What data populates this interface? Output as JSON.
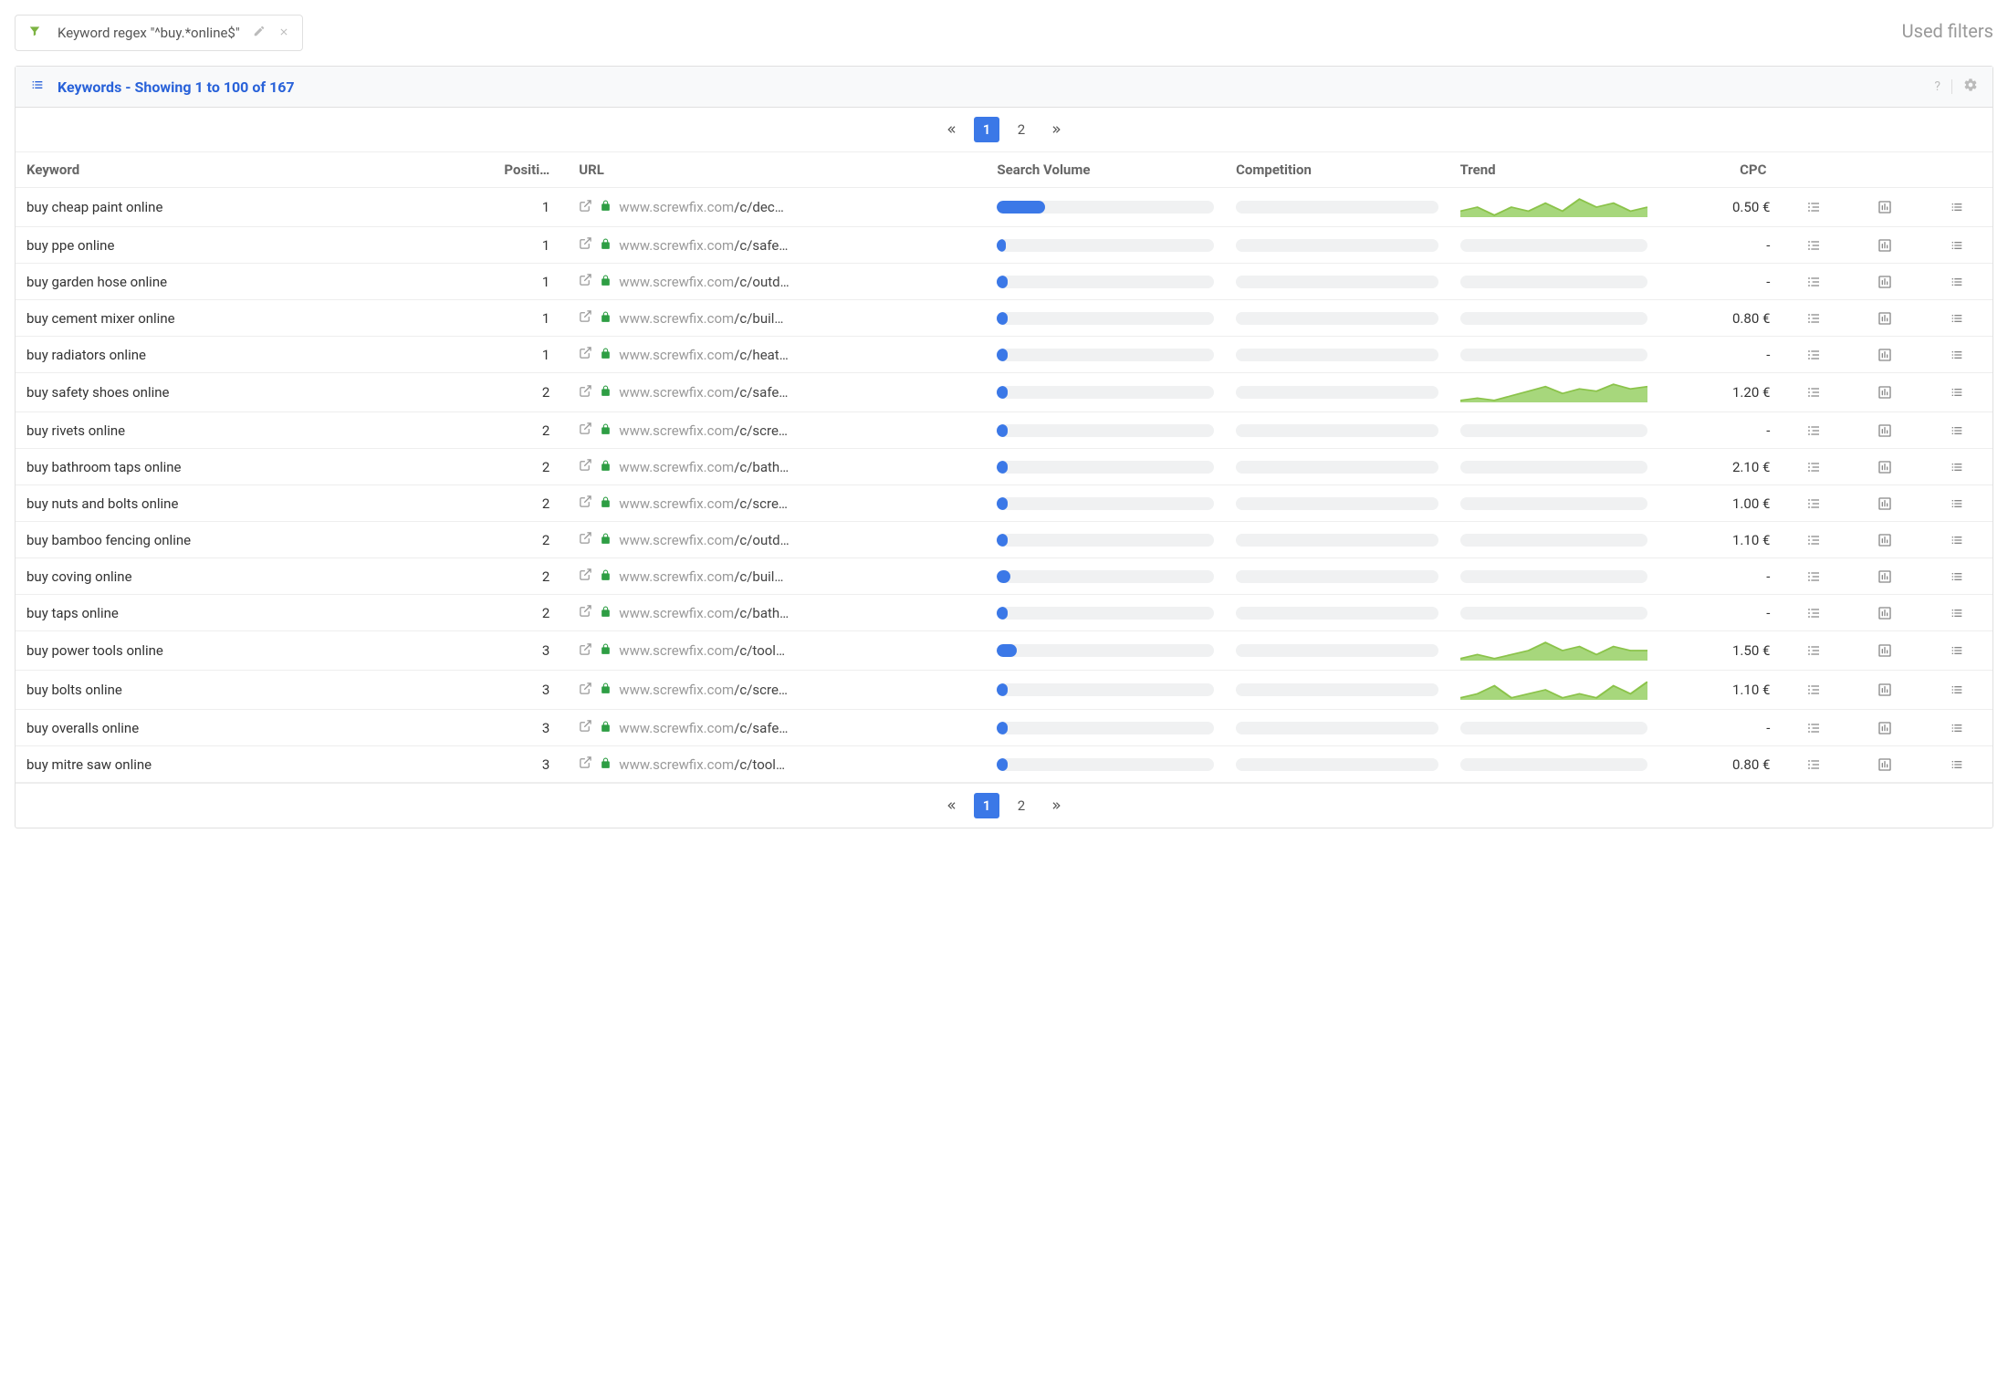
{
  "filter_chip": {
    "label": "Keyword regex \"^buy.*online$\""
  },
  "used_filters_label": "Used filters",
  "panel_title": "Keywords - Showing 1 to 100 of 167",
  "pagination": {
    "pages": [
      "1",
      "2"
    ],
    "active": "1"
  },
  "columns": {
    "keyword": "Keyword",
    "position": "Positi…",
    "url": "URL",
    "search_volume": "Search Volume",
    "competition": "Competition",
    "trend": "Trend",
    "cpc": "CPC"
  },
  "url_domain": "www.screwfix.com",
  "rows": [
    {
      "keyword": "buy cheap paint online",
      "position": "1",
      "url_path": "/c/dec…",
      "sv_pct": 22,
      "comp_pct": 0,
      "trend": [
        6,
        7,
        5,
        7,
        6,
        8,
        6,
        9,
        7,
        8,
        6,
        7
      ],
      "cpc": "0.50 €"
    },
    {
      "keyword": "buy ppe online",
      "position": "1",
      "url_path": "/c/safe…",
      "sv_pct": 4,
      "comp_pct": 0,
      "trend": null,
      "cpc": "-"
    },
    {
      "keyword": "buy garden hose online",
      "position": "1",
      "url_path": "/c/outd…",
      "sv_pct": 5,
      "comp_pct": 0,
      "trend": null,
      "cpc": "-"
    },
    {
      "keyword": "buy cement mixer online",
      "position": "1",
      "url_path": "/c/buil…",
      "sv_pct": 5,
      "comp_pct": 0,
      "trend": null,
      "cpc": "0.80 €"
    },
    {
      "keyword": "buy radiators online",
      "position": "1",
      "url_path": "/c/heat…",
      "sv_pct": 5,
      "comp_pct": 0,
      "trend": null,
      "cpc": "-"
    },
    {
      "keyword": "buy safety shoes online",
      "position": "2",
      "url_path": "/c/safe…",
      "sv_pct": 5,
      "comp_pct": 0,
      "trend": [
        4,
        5,
        4,
        6,
        8,
        10,
        7,
        9,
        8,
        11,
        9,
        10
      ],
      "cpc": "1.20 €"
    },
    {
      "keyword": "buy rivets online",
      "position": "2",
      "url_path": "/c/scre…",
      "sv_pct": 5,
      "comp_pct": 0,
      "trend": null,
      "cpc": "-"
    },
    {
      "keyword": "buy bathroom taps online",
      "position": "2",
      "url_path": "/c/bath…",
      "sv_pct": 5,
      "comp_pct": 0,
      "trend": null,
      "cpc": "2.10 €"
    },
    {
      "keyword": "buy nuts and bolts online",
      "position": "2",
      "url_path": "/c/scre…",
      "sv_pct": 5,
      "comp_pct": 0,
      "trend": null,
      "cpc": "1.00 €"
    },
    {
      "keyword": "buy bamboo fencing online",
      "position": "2",
      "url_path": "/c/outd…",
      "sv_pct": 5,
      "comp_pct": 0,
      "trend": null,
      "cpc": "1.10 €"
    },
    {
      "keyword": "buy coving online",
      "position": "2",
      "url_path": "/c/buil…",
      "sv_pct": 6,
      "comp_pct": 0,
      "trend": null,
      "cpc": "-"
    },
    {
      "keyword": "buy taps online",
      "position": "2",
      "url_path": "/c/bath…",
      "sv_pct": 5,
      "comp_pct": 0,
      "trend": null,
      "cpc": "-"
    },
    {
      "keyword": "buy power tools online",
      "position": "3",
      "url_path": "/c/tool…",
      "sv_pct": 9,
      "comp_pct": 0,
      "trend": [
        5,
        6,
        5,
        6,
        7,
        9,
        7,
        8,
        6,
        8,
        7,
        7
      ],
      "cpc": "1.50 €"
    },
    {
      "keyword": "buy bolts online",
      "position": "3",
      "url_path": "/c/scre…",
      "sv_pct": 5,
      "comp_pct": 0,
      "trend": [
        5,
        6,
        8,
        5,
        6,
        7,
        5,
        6,
        5,
        8,
        6,
        9
      ],
      "cpc": "1.10 €"
    },
    {
      "keyword": "buy overalls online",
      "position": "3",
      "url_path": "/c/safe…",
      "sv_pct": 5,
      "comp_pct": 0,
      "trend": null,
      "cpc": "-"
    },
    {
      "keyword": "buy mitre saw online",
      "position": "3",
      "url_path": "/c/tool…",
      "sv_pct": 5,
      "comp_pct": 0,
      "trend": null,
      "cpc": "0.80 €"
    }
  ]
}
